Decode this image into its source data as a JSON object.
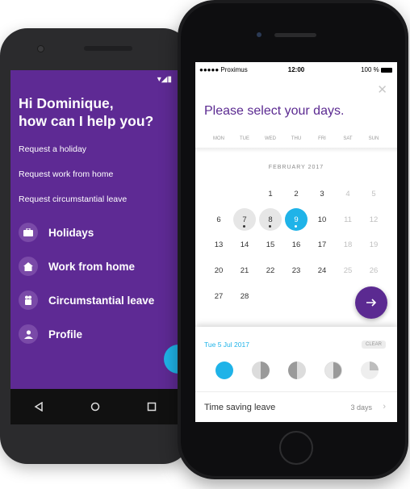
{
  "android": {
    "greeting": "Hi Dominique,\nhow can I help you?",
    "links": [
      "Request a holiday",
      "Request work from home",
      "Request circumstantial leave"
    ],
    "menu": [
      {
        "icon": "briefcase-icon",
        "label": "Holidays"
      },
      {
        "icon": "home-icon",
        "label": "Work from home"
      },
      {
        "icon": "family-icon",
        "label": "Circumstantial leave"
      },
      {
        "icon": "person-icon",
        "label": "Profile"
      }
    ],
    "brand_color": "#5e2a94",
    "accent_color": "#1fb3e8"
  },
  "iphone": {
    "status": {
      "carrier": "●●●●● Proximus",
      "time": "12:00",
      "battery": "100 %"
    },
    "close_glyph": "✕",
    "title": "Please select your days.",
    "weekdays": [
      "MON",
      "TUE",
      "WED",
      "THU",
      "FRI",
      "SAT",
      "SUN"
    ],
    "month": "FEBRUARY 2017",
    "weeks": [
      [
        null,
        null,
        {
          "d": "1"
        },
        {
          "d": "2"
        },
        {
          "d": "3"
        },
        {
          "d": "4",
          "dim": true
        },
        {
          "d": "5",
          "dim": true
        }
      ],
      [
        {
          "d": "6"
        },
        {
          "d": "7",
          "grey": true,
          "dot": true
        },
        {
          "d": "8",
          "grey": true,
          "dot": true
        },
        {
          "d": "9",
          "sel": true,
          "dot": true
        },
        {
          "d": "10"
        },
        {
          "d": "11",
          "dim": true
        },
        {
          "d": "12",
          "dim": true
        }
      ],
      [
        {
          "d": "13"
        },
        {
          "d": "14"
        },
        {
          "d": "15"
        },
        {
          "d": "16"
        },
        {
          "d": "17"
        },
        {
          "d": "18",
          "dim": true
        },
        {
          "d": "19",
          "dim": true
        }
      ],
      [
        {
          "d": "20"
        },
        {
          "d": "21"
        },
        {
          "d": "22"
        },
        {
          "d": "23"
        },
        {
          "d": "24"
        },
        {
          "d": "25",
          "dim": true
        },
        {
          "d": "26",
          "dim": true
        }
      ],
      [
        {
          "d": "27"
        },
        {
          "d": "28"
        },
        null,
        null,
        null,
        null,
        null
      ]
    ],
    "selected_date": "Tue 5 Jul 2017",
    "clear_label": "CLEAR",
    "day_parts": [
      "full",
      "half-right",
      "half-left",
      "half-right-light",
      "quarter"
    ],
    "leave_type": {
      "label": "Time saving leave",
      "value": "3 days"
    },
    "accent_color": "#1fb3e8",
    "brand_color": "#5b2a91"
  }
}
